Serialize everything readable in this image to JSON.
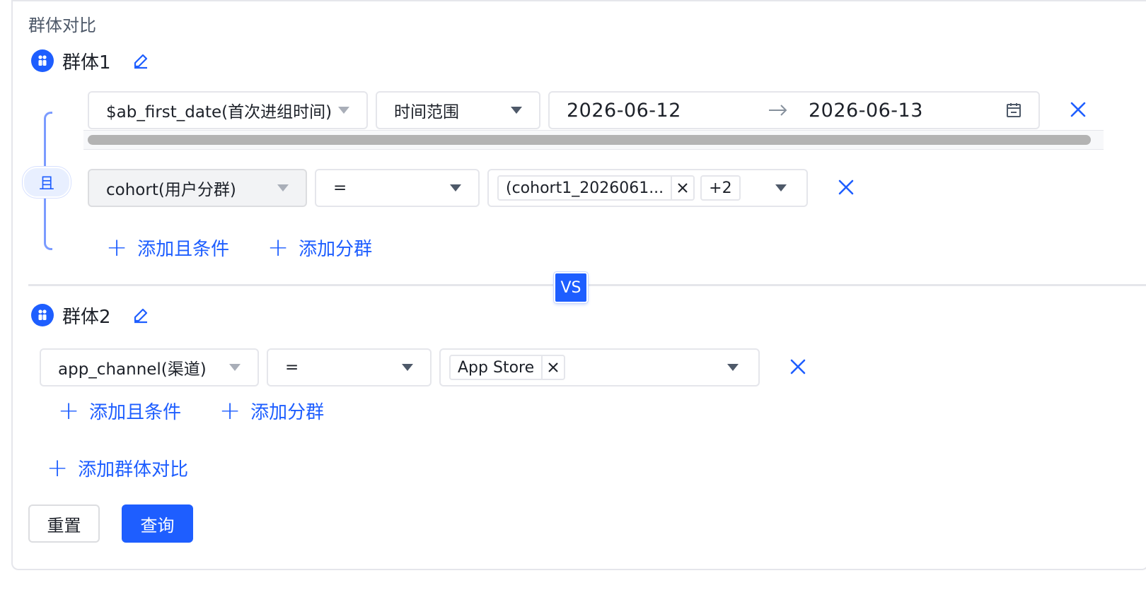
{
  "section_title": "群体对比",
  "group1": {
    "title": "群体1",
    "logic_label": "且",
    "row1": {
      "field": "$ab_first_date(首次进组时间)",
      "operator": "时间范围",
      "date_start": "2026-06-12",
      "date_end": "2026-06-13"
    },
    "row2": {
      "field": "cohort(用户分群)",
      "operator": "=",
      "tag": "(cohort1_2026061...",
      "more": "+2"
    },
    "add_and_label": "添加且条件",
    "add_subgroup_label": "添加分群"
  },
  "vs_label": "VS",
  "group2": {
    "title": "群体2",
    "row1": {
      "field": "app_channel(渠道)",
      "operator": "=",
      "tag": "App Store"
    },
    "add_and_label": "添加且条件",
    "add_subgroup_label": "添加分群"
  },
  "add_compare_label": "添加群体对比",
  "buttons": {
    "reset": "重置",
    "query": "查询"
  },
  "colors": {
    "accent": "#1e5eff",
    "border": "#e5e6eb"
  }
}
